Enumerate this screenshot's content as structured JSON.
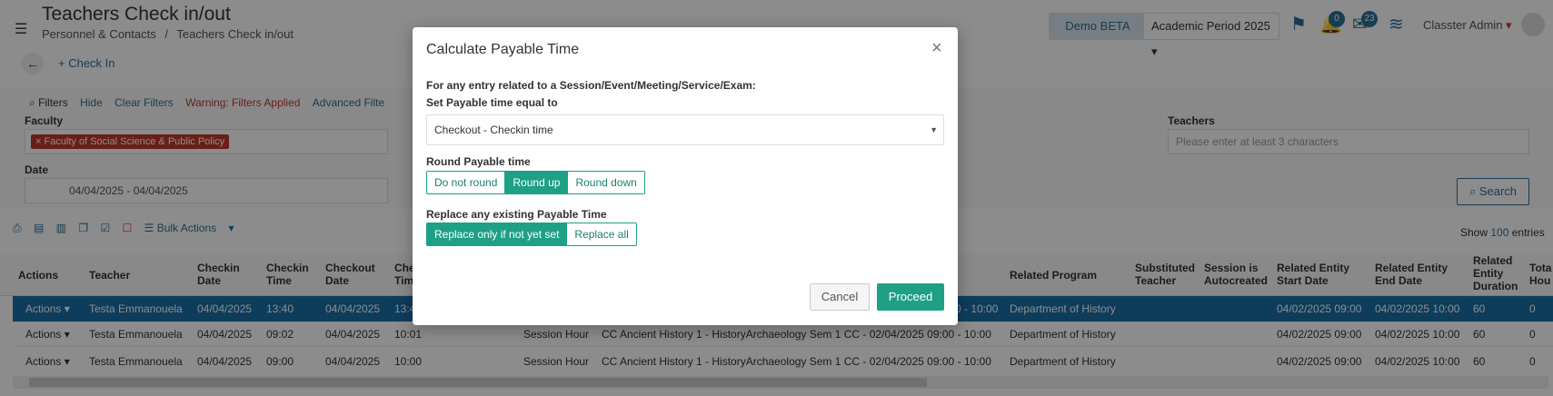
{
  "header": {
    "title": "Teachers Check in/out",
    "breadcrumb": [
      "Personnel & Contacts",
      "/",
      "Teachers Check in/out"
    ],
    "demo_label": "Demo BETA",
    "period_label": "Academic Period 2025",
    "notif_count": "0",
    "mail_count": "23",
    "user": "Classter Admin"
  },
  "toolbar": {
    "checkin_label": "+ Check In"
  },
  "filters": {
    "filters_label": "Filters",
    "hide_label": "Hide",
    "clear_label": "Clear Filters",
    "warning_label": "Warning: Filters Applied",
    "advanced_label": "Advanced Filte",
    "faculty_label": "Faculty",
    "faculty_tag": "× Faculty of Social Science & Public Policy",
    "date_label": "Date",
    "date_value": "04/04/2025 - 04/04/2025",
    "teachers_label": "Teachers",
    "teachers_placeholder": "Please enter at least 3 characters",
    "search_label": "Search"
  },
  "table": {
    "bulk_label": "Bulk Actions",
    "show_label": "Show",
    "show_value": "100",
    "entries_label": "entries",
    "headers": {
      "actions": "Actions",
      "teacher": "Teacher",
      "checkin_date": "Checkin Date",
      "checkin_time": "Checkin Time",
      "checkout_date": "Checkout Date",
      "checkout_time": "Che Tim",
      "related_program": "Related Program",
      "substituted": "Substituted Teacher",
      "autocreated": "Session is Autocreated",
      "start_date": "Related Entity Start Date",
      "end_date": "Related Entity End Date",
      "duration": "Related Entity Duration",
      "total": "Tota Hou"
    },
    "rows": [
      {
        "actions": "Actions",
        "teacher": "Testa Emmanouela",
        "cdate": "04/04/2025",
        "ctime": "13:40",
        "odate": "04/04/2025",
        "otime": "13:4",
        "type": "",
        "entity": "0 - 10:00",
        "program": "Department of History",
        "start": "04/02/2025 09:00",
        "end": "04/02/2025 10:00",
        "dur": "60",
        "total": "0"
      },
      {
        "actions": "Actions",
        "teacher": "Testa Emmanouela",
        "cdate": "04/04/2025",
        "ctime": "09:02",
        "odate": "04/04/2025",
        "otime": "10:01",
        "type": "Session Hour",
        "entity": "CC Ancient History 1 - HistoryArchaeology Sem 1 CC - 02/04/2025 09:00 - 10:00",
        "program": "Department of History",
        "start": "04/02/2025 09:00",
        "end": "04/02/2025 10:00",
        "dur": "60",
        "total": "0"
      },
      {
        "actions": "Actions",
        "teacher": "Testa Emmanouela",
        "cdate": "04/04/2025",
        "ctime": "09:00",
        "odate": "04/04/2025",
        "otime": "10:00",
        "type": "Session Hour",
        "entity": "CC Ancient History 1 - HistoryArchaeology Sem 1 CC - 02/04/2025 09:00 - 10:00",
        "program": "Department of History",
        "start": "04/02/2025 09:00",
        "end": "04/02/2025 10:00",
        "dur": "60",
        "total": "0"
      }
    ]
  },
  "modal": {
    "title": "Calculate Payable Time",
    "close": "×",
    "intro": "For any entry related to a Session/Event/Meeting/Service/Exam:",
    "set_label": "Set Payable time equal to",
    "select_value": "Checkout - Checkin time",
    "round_label": "Round Payable time",
    "round_options": [
      "Do not round",
      "Round up",
      "Round down"
    ],
    "round_selected": "Round up",
    "replace_label": "Replace any existing Payable Time",
    "replace_options": [
      "Replace only if not yet set",
      "Replace all"
    ],
    "replace_selected": "Replace only if not yet set",
    "cancel_label": "Cancel",
    "proceed_label": "Proceed"
  },
  "colors": {
    "accent": "#1ea086",
    "primary": "#2a6f9a",
    "selected_row": "#1a6fa8",
    "tag": "#c0392b"
  }
}
